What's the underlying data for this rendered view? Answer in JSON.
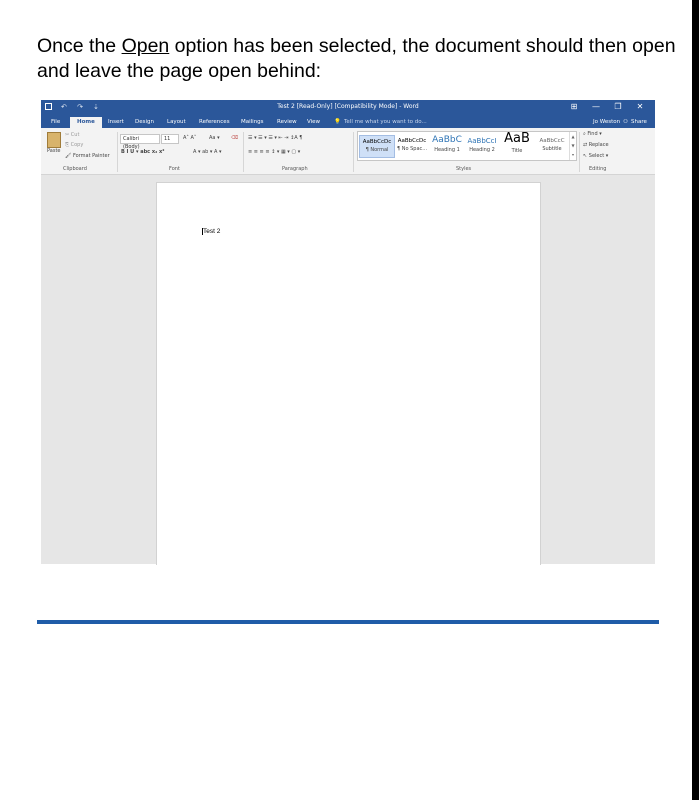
{
  "intro": {
    "before": "Once the ",
    "link": "Open",
    "after": " option has been selected, the document should then open and leave the page open behind:"
  },
  "word": {
    "title": "Test 2 [Read-Only] [Compatibility Mode] - Word",
    "qat": "↶ ↷ ⇣",
    "window_controls": [
      "⊞",
      "—",
      "❐",
      "✕"
    ],
    "tabs": [
      "File",
      "Home",
      "Insert",
      "Design",
      "Layout",
      "References",
      "Mailings",
      "Review",
      "View"
    ],
    "tell_me": "Tell me what you want to do...",
    "user": "Jo Weston",
    "share": "Share",
    "clipboard": {
      "paste": "Paste",
      "cut": "Cut",
      "copy": "Copy",
      "format_painter": "Format Painter",
      "label": "Clipboard"
    },
    "font": {
      "name": "Calibri (Body)",
      "size": "11",
      "grow_shrink": "A˄ A˅",
      "case": "Aa ▾",
      "format_row": "B  I  U ▾ abc x₂ x²",
      "color_row": "A ▾  ab ▾  A ▾",
      "label": "Font"
    },
    "paragraph": {
      "row1": "☰ ▾ ☰ ▾ ☰ ▾  ⇤  ⇥  ↕A  ¶",
      "row2": "≡  ≡  ≡  ≡  ↕ ▾  ▦ ▾  ▢ ▾",
      "label": "Paragraph"
    },
    "styles": [
      {
        "sample": "AaBbCcDc",
        "name": "¶ Normal"
      },
      {
        "sample": "AaBbCcDc",
        "name": "¶ No Spac..."
      },
      {
        "sample": "AaBbC",
        "name": "Heading 1"
      },
      {
        "sample": "AaBbCcI",
        "name": "Heading 2"
      },
      {
        "sample": "AaB",
        "name": "Title"
      },
      {
        "sample": "AaBbCcC",
        "name": "Subtitle"
      }
    ],
    "styles_label": "Styles",
    "editing": {
      "find": "Find ▾",
      "replace": "Replace",
      "select": "Select ▾",
      "label": "Editing"
    },
    "document_text": "Test 2"
  },
  "colors": {
    "word_blue": "#2b579a",
    "rule_blue": "#1f5ca8"
  }
}
